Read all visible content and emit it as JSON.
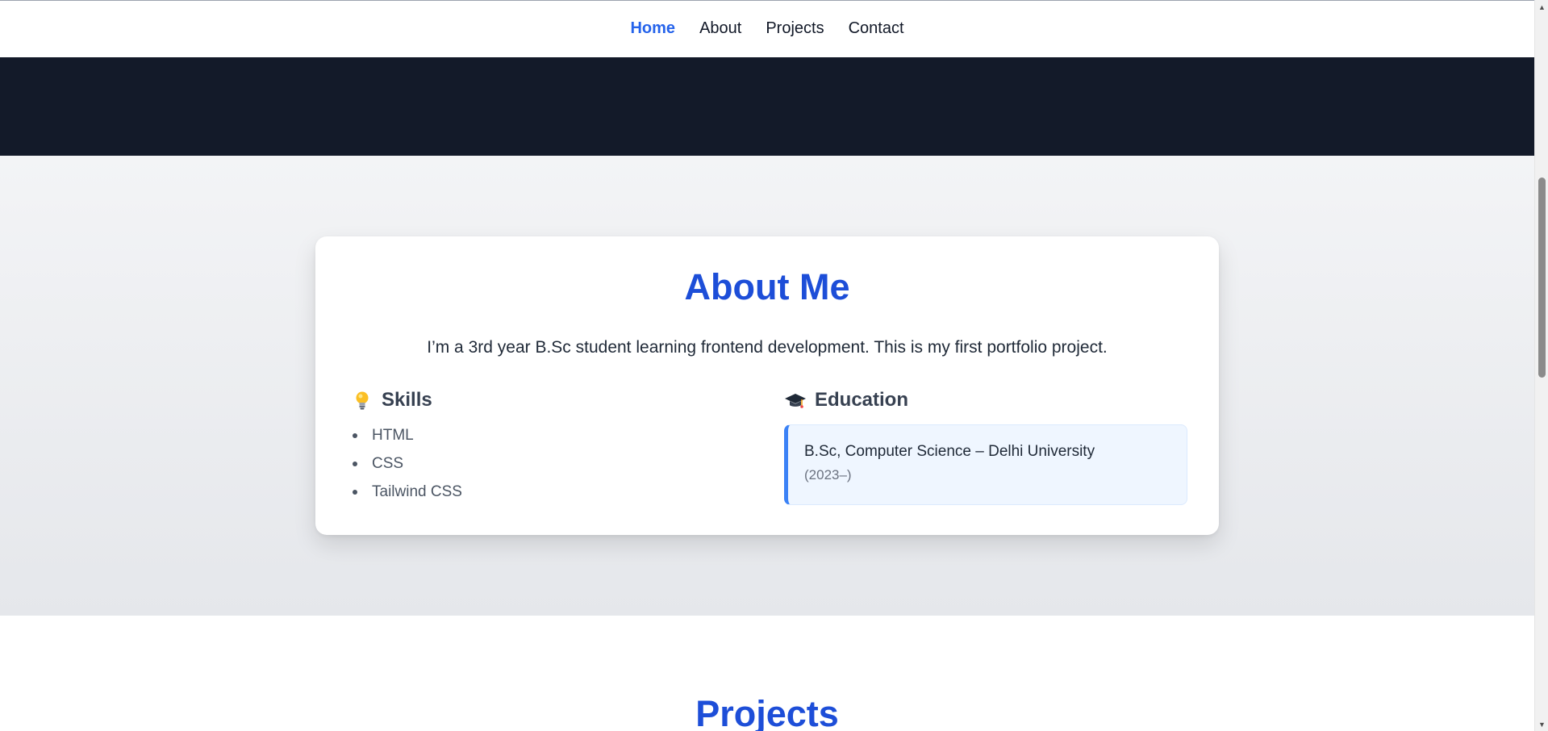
{
  "nav": {
    "items": [
      {
        "label": "Home",
        "active": true
      },
      {
        "label": "About",
        "active": false
      },
      {
        "label": "Projects",
        "active": false
      },
      {
        "label": "Contact",
        "active": false
      }
    ]
  },
  "about": {
    "title": "About Me",
    "intro": "I’m a 3rd year B.Sc student learning frontend development. This is my first portfolio project.",
    "skills": {
      "icon": "lightbulb-icon",
      "heading": "Skills",
      "items": [
        "HTML",
        "CSS",
        "Tailwind CSS"
      ]
    },
    "education": {
      "icon": "graduation-cap-icon",
      "heading": "Education",
      "degree": "B.Sc, Computer Science – Delhi University",
      "years": "(2023–)"
    }
  },
  "projects": {
    "title": "Projects"
  },
  "colors": {
    "accent": "#2563eb",
    "heading_blue": "#1d4ed8",
    "hero_dark": "#131a29",
    "edu_border": "#3b82f6"
  }
}
